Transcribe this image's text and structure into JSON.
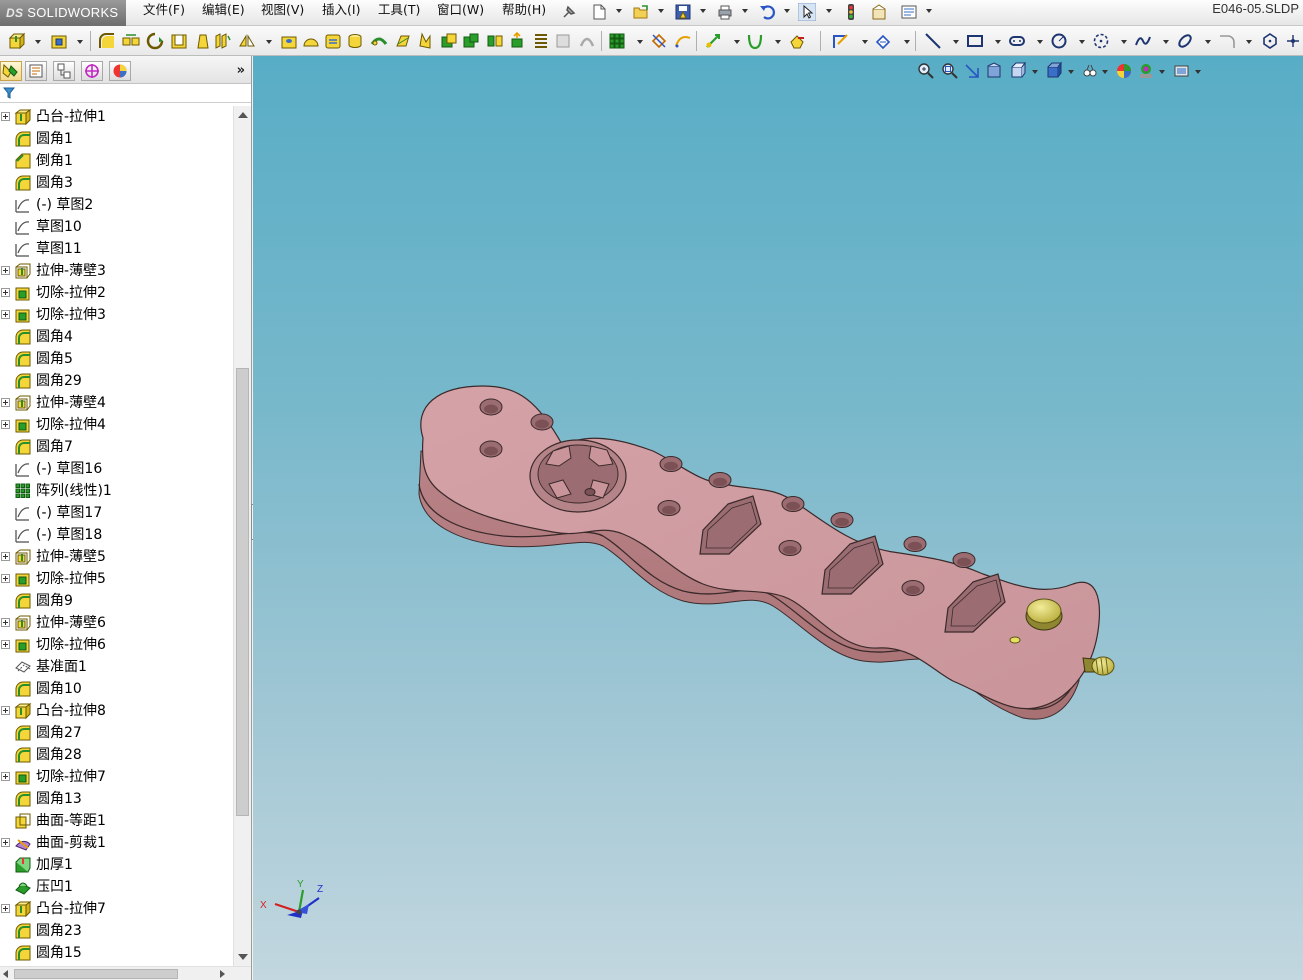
{
  "app": {
    "brand_prefix": "DS",
    "brand_name": "SOLIDWORKS",
    "document_title": "E046-05.SLDP"
  },
  "menu": {
    "items": [
      {
        "id": "file",
        "label": "文件(F)"
      },
      {
        "id": "edit",
        "label": "编辑(E)"
      },
      {
        "id": "view",
        "label": "视图(V)"
      },
      {
        "id": "insert",
        "label": "插入(I)"
      },
      {
        "id": "tools",
        "label": "工具(T)"
      },
      {
        "id": "window",
        "label": "窗口(W)"
      },
      {
        "id": "help",
        "label": "帮助(H)"
      }
    ]
  },
  "panel": {
    "tabs": [
      {
        "id": "feature-manager",
        "icon": "feature-tree-icon",
        "active": true
      },
      {
        "id": "property-manager",
        "icon": "property-manager-icon",
        "active": false
      },
      {
        "id": "configuration-manager",
        "icon": "configuration-manager-icon",
        "active": false
      },
      {
        "id": "dimxpert-manager",
        "icon": "dimxpert-icon",
        "active": false
      },
      {
        "id": "display-manager",
        "icon": "display-manager-icon",
        "active": false
      }
    ],
    "more_label": "»",
    "filter_icon": "filter-icon"
  },
  "tree": {
    "items": [
      {
        "label": "凸台-拉伸1",
        "type": "boss-extrude",
        "expandable": true
      },
      {
        "label": "圆角1",
        "type": "fillet",
        "expandable": false
      },
      {
        "label": "倒角1",
        "type": "chamfer",
        "expandable": false
      },
      {
        "label": "圆角3",
        "type": "fillet",
        "expandable": false
      },
      {
        "label": "(-) 草图2",
        "type": "sketch",
        "expandable": false
      },
      {
        "label": "草图10",
        "type": "sketch",
        "expandable": false
      },
      {
        "label": "草图11",
        "type": "sketch",
        "expandable": false
      },
      {
        "label": "拉伸-薄壁3",
        "type": "thin-extrude",
        "expandable": true
      },
      {
        "label": "切除-拉伸2",
        "type": "cut-extrude",
        "expandable": true
      },
      {
        "label": "切除-拉伸3",
        "type": "cut-extrude",
        "expandable": true
      },
      {
        "label": "圆角4",
        "type": "fillet",
        "expandable": false
      },
      {
        "label": "圆角5",
        "type": "fillet",
        "expandable": false
      },
      {
        "label": "圆角29",
        "type": "fillet",
        "expandable": false
      },
      {
        "label": "拉伸-薄壁4",
        "type": "thin-extrude",
        "expandable": true
      },
      {
        "label": "切除-拉伸4",
        "type": "cut-extrude",
        "expandable": true
      },
      {
        "label": "圆角7",
        "type": "fillet",
        "expandable": false
      },
      {
        "label": "(-) 草图16",
        "type": "sketch",
        "expandable": false
      },
      {
        "label": "阵列(线性)1",
        "type": "linear-pattern",
        "expandable": false
      },
      {
        "label": "(-) 草图17",
        "type": "sketch",
        "expandable": false
      },
      {
        "label": "(-) 草图18",
        "type": "sketch",
        "expandable": false
      },
      {
        "label": "拉伸-薄壁5",
        "type": "thin-extrude",
        "expandable": true
      },
      {
        "label": "切除-拉伸5",
        "type": "cut-extrude",
        "expandable": true
      },
      {
        "label": "圆角9",
        "type": "fillet",
        "expandable": false
      },
      {
        "label": "拉伸-薄壁6",
        "type": "thin-extrude",
        "expandable": true
      },
      {
        "label": "切除-拉伸6",
        "type": "cut-extrude",
        "expandable": true
      },
      {
        "label": "基准面1",
        "type": "plane",
        "expandable": false
      },
      {
        "label": "圆角10",
        "type": "fillet",
        "expandable": false
      },
      {
        "label": "凸台-拉伸8",
        "type": "boss-extrude",
        "expandable": true
      },
      {
        "label": "圆角27",
        "type": "fillet",
        "expandable": false
      },
      {
        "label": "圆角28",
        "type": "fillet",
        "expandable": false
      },
      {
        "label": "切除-拉伸7",
        "type": "cut-extrude",
        "expandable": true
      },
      {
        "label": "圆角13",
        "type": "fillet",
        "expandable": false
      },
      {
        "label": "曲面-等距1",
        "type": "offset-surface",
        "expandable": false
      },
      {
        "label": "曲面-剪裁1",
        "type": "trim-surface",
        "expandable": true
      },
      {
        "label": "加厚1",
        "type": "thicken",
        "expandable": false
      },
      {
        "label": "压凹1",
        "type": "indent",
        "expandable": false
      },
      {
        "label": "凸台-拉伸7",
        "type": "boss-extrude",
        "expandable": true
      },
      {
        "label": "圆角23",
        "type": "fillet",
        "expandable": false
      },
      {
        "label": "圆角15",
        "type": "fillet",
        "expandable": false
      }
    ]
  },
  "viewport": {
    "background_top": "#58adc6",
    "background_bottom": "#c2d7df",
    "model_color": "#c9959a",
    "button_color": "#d8cf6a",
    "triad_labels": {
      "x": "X",
      "y": "Y",
      "z": "Z"
    }
  },
  "colors": {
    "x_axis": "#d42020",
    "y_axis": "#2a9d2a",
    "z_axis": "#2030c8"
  }
}
